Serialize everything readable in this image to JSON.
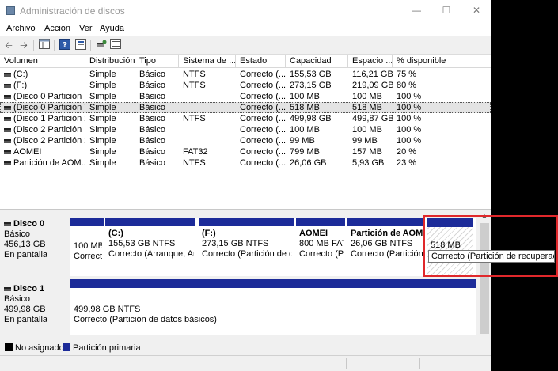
{
  "window": {
    "title": "Administración de discos"
  },
  "menu": [
    "Archivo",
    "Acción",
    "Ver",
    "Ayuda"
  ],
  "toolbar": [
    "back-arrow-icon",
    "forward-arrow-icon",
    "console-tree-icon",
    "help-icon",
    "properties-icon",
    "rescan-icon",
    "list-view-icon"
  ],
  "volume_table": {
    "columns": [
      "Volumen",
      "Distribución",
      "Tipo",
      "Sistema de ...",
      "Estado",
      "Capacidad",
      "Espacio ...",
      "% disponible"
    ],
    "rows": [
      [
        "(C:)",
        "Simple",
        "Básico",
        "NTFS",
        "Correcto (...",
        "155,53 GB",
        "116,21 GB",
        "75 %"
      ],
      [
        "(F:)",
        "Simple",
        "Básico",
        "NTFS",
        "Correcto (...",
        "273,15 GB",
        "219,09 GB",
        "80 %"
      ],
      [
        "(Disco 0 Partición 1)",
        "Simple",
        "Básico",
        "",
        "Correcto (...",
        "100 MB",
        "100 MB",
        "100 %"
      ],
      [
        "(Disco 0 Partición 7)",
        "Simple",
        "Básico",
        "",
        "Correcto (...",
        "518 MB",
        "518 MB",
        "100 %"
      ],
      [
        "(Disco 1 Partición 2)",
        "Simple",
        "Básico",
        "NTFS",
        "Correcto (...",
        "499,98 GB",
        "499,87 GB",
        "100 %"
      ],
      [
        "(Disco 2 Partición 1)",
        "Simple",
        "Básico",
        "",
        "Correcto (...",
        "100 MB",
        "100 MB",
        "100 %"
      ],
      [
        "(Disco 2 Partición 2)",
        "Simple",
        "Básico",
        "",
        "Correcto (...",
        "99 MB",
        "99 MB",
        "100 %"
      ],
      [
        "AOMEI",
        "Simple",
        "Básico",
        "FAT32",
        "Correcto (...",
        "799 MB",
        "157 MB",
        "20 %"
      ],
      [
        "Partición de AOM...",
        "Simple",
        "Básico",
        "NTFS",
        "Correcto (...",
        "26,06 GB",
        "5,93 GB",
        "23 %"
      ]
    ]
  },
  "disks": [
    {
      "name": "Disco 0",
      "type": "Básico",
      "size": "456,13 GB",
      "status": "En pantalla",
      "partitions": [
        {
          "title": "",
          "line1": "100 MB",
          "line2": "Correct",
          "hatched": false
        },
        {
          "title": "(C:)",
          "line1": "155,53 GB NTFS",
          "line2": "Correcto (Arranque, Arc",
          "hatched": false
        },
        {
          "title": "(F:)",
          "line1": "273,15 GB NTFS",
          "line2": "Correcto (Partición de da",
          "hatched": false
        },
        {
          "title": "AOMEI",
          "line1": "800 MB FAT",
          "line2": "Correcto (Pa",
          "hatched": false
        },
        {
          "title": "Partición de AOME",
          "line1": "26,06 GB NTFS",
          "line2": "Correcto (Partición",
          "hatched": false
        },
        {
          "title": "",
          "line1": "518 MB",
          "line2": "",
          "hatched": true
        }
      ]
    },
    {
      "name": "Disco 1",
      "type": "Básico",
      "size": "499,98 GB",
      "status": "En pantalla",
      "partitions": [
        {
          "title": "",
          "line1": "499,98 GB NTFS",
          "line2": "Correcto (Partición de datos básicos)",
          "hatched": false
        }
      ]
    }
  ],
  "tooltip": "Correcto (Partición de recuperación)",
  "legend": [
    {
      "label": "No asignado",
      "color": "#000000"
    },
    {
      "label": "Partición primaria",
      "color": "#1c2b99"
    }
  ],
  "colors": {
    "primary_partition": "#1c2b99",
    "highlight": "#e0282b"
  }
}
